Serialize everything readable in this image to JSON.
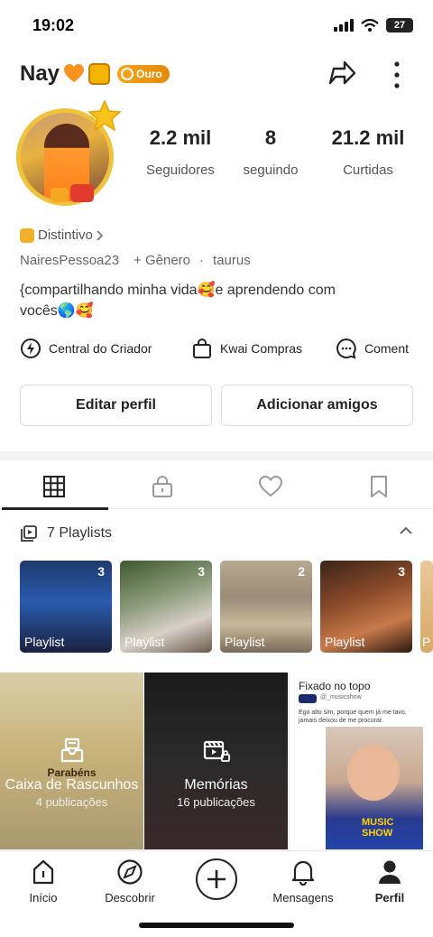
{
  "status": {
    "time": "19:02",
    "battery": "27"
  },
  "profile": {
    "name": "Nay",
    "badge_label": "Ouro",
    "distintivo_label": "Distintivo",
    "username": "NairesPessoa23",
    "gender_label": "+ Gênero",
    "separator": "·",
    "sign": "taurus",
    "bio_line1": "{compartilhando minha vida🥰e aprendendo com",
    "bio_line2": "vocês🌎🥰"
  },
  "stats": [
    {
      "value": "2.2 mil",
      "label": "Seguidores"
    },
    {
      "value": "8",
      "label": "seguindo"
    },
    {
      "value": "21.2 mil",
      "label": "Curtidas"
    }
  ],
  "shortcuts": [
    {
      "label": "Central do Criador",
      "icon": "lightning-circle-icon"
    },
    {
      "label": "Kwai Compras",
      "icon": "shopping-bag-icon"
    },
    {
      "label": "Coment",
      "icon": "comment-icon"
    }
  ],
  "buttons": {
    "edit": "Editar perfil",
    "add_friends": "Adicionar amigos"
  },
  "tabs": [
    {
      "icon": "grid-icon",
      "selected": true
    },
    {
      "icon": "lock-icon",
      "selected": false
    },
    {
      "icon": "heart-icon",
      "selected": false
    },
    {
      "icon": "bookmark-icon",
      "selected": false
    }
  ],
  "playlists": {
    "title": "7 Playlists",
    "items": [
      {
        "label": "Playlist",
        "count": "3"
      },
      {
        "label": "Playlist",
        "count": "3"
      },
      {
        "label": "Playlist",
        "count": "2"
      },
      {
        "label": "Playlist",
        "count": "3"
      },
      {
        "label": "P",
        "count": ""
      }
    ]
  },
  "grid": [
    {
      "title": "Caixa de Rascunhos",
      "subtitle": "4 publicações",
      "overlay_text": "Parabéns"
    },
    {
      "title": "Memórias",
      "subtitle": "16 publicações"
    },
    {
      "title": "Fixado no topo",
      "handle": "@_musicshow",
      "caption": "Ego alto sim, porque quem já me tavo, jamais deixou de me procurar.",
      "brand": "MUSIC SHOW"
    }
  ],
  "nav": [
    {
      "label": "Início",
      "icon": "home-icon"
    },
    {
      "label": "Descobrir",
      "icon": "compass-icon"
    },
    {
      "label": "",
      "icon": "plus-icon"
    },
    {
      "label": "Mensagens",
      "icon": "bell-icon"
    },
    {
      "label": "Perfil",
      "icon": "person-icon"
    }
  ],
  "colors": {
    "accent_gold": "#f0a020",
    "text": "#222222"
  }
}
